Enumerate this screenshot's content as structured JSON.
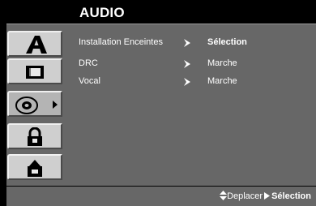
{
  "menu": {
    "title": "AUDIO"
  },
  "tabs": [
    {
      "name": "language",
      "icon": "letter-a-icon"
    },
    {
      "name": "display",
      "icon": "tv-screen-icon"
    },
    {
      "name": "audio",
      "icon": "speaker-icon",
      "active": true
    },
    {
      "name": "lock",
      "icon": "padlock-icon"
    },
    {
      "name": "others",
      "icon": "gear-icon"
    }
  ],
  "settings": [
    {
      "label": "Installation Enceintes",
      "value": "Sélection"
    },
    {
      "label": "DRC",
      "value": "Marche"
    },
    {
      "label": "Vocal",
      "value": "Marche"
    }
  ],
  "footer": {
    "move": "Deplacer",
    "select": "Sélection"
  },
  "colors": {
    "panel": "#676767",
    "tab": "#cfcfcf",
    "text": "#ffffff"
  }
}
